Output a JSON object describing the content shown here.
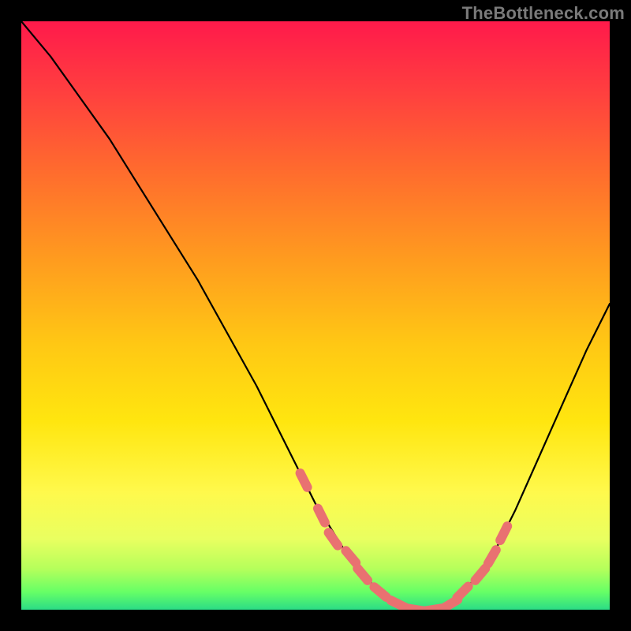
{
  "watermark": "TheBottleneck.com",
  "colors": {
    "background": "#000000",
    "curve": "#000000",
    "marker": "#e97171",
    "gradient_top": "#ff1a4b",
    "gradient_bottom": "#2bdc86"
  },
  "chart_data": {
    "type": "line",
    "title": "",
    "xlabel": "",
    "ylabel": "",
    "xlim": [
      0,
      100
    ],
    "ylim": [
      0,
      100
    ],
    "grid": false,
    "legend": false,
    "curve": {
      "name": "bottleneck-curve",
      "x": [
        0,
        5,
        10,
        15,
        20,
        25,
        30,
        35,
        40,
        45,
        50,
        55,
        58,
        61,
        64,
        67,
        70,
        73,
        76,
        80,
        84,
        88,
        92,
        96,
        100
      ],
      "values": [
        100,
        94,
        87,
        80,
        72,
        64,
        56,
        47,
        38,
        28,
        18,
        10,
        6,
        3,
        1,
        0,
        0,
        1,
        4,
        9,
        17,
        26,
        35,
        44,
        52
      ]
    },
    "marker_cluster": {
      "name": "highlighted-region",
      "x": [
        48,
        51,
        53,
        56,
        58,
        61,
        64,
        67,
        70,
        73,
        75,
        78,
        80,
        82
      ],
      "values": [
        22,
        16,
        12,
        9,
        6,
        3,
        1,
        0,
        0,
        1,
        3,
        6,
        9,
        13
      ]
    }
  }
}
